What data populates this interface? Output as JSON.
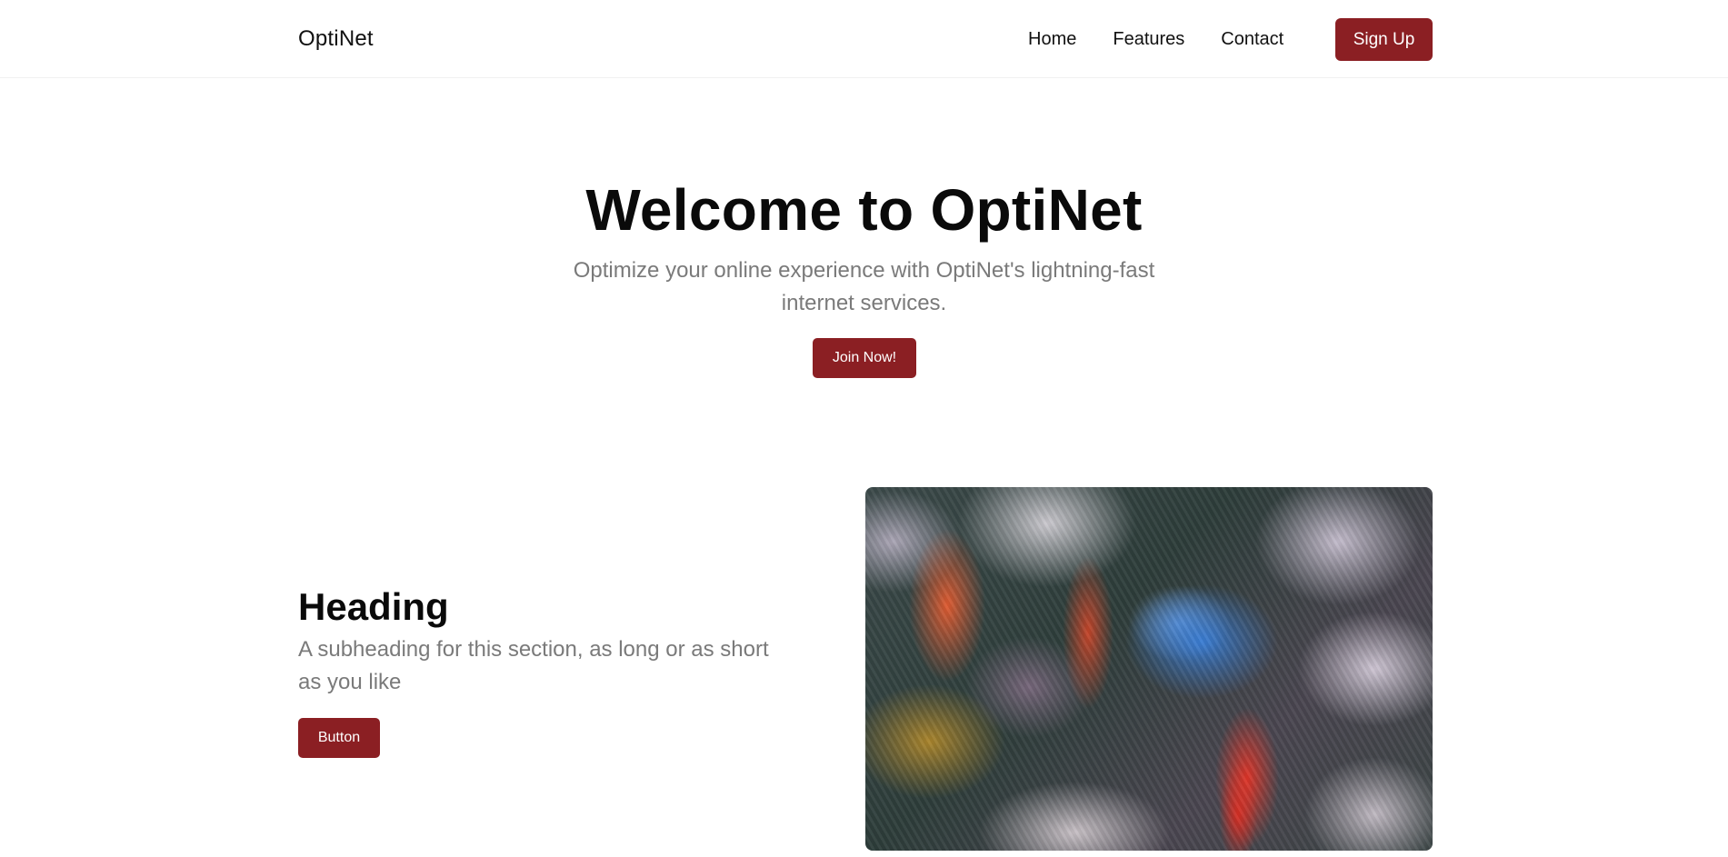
{
  "header": {
    "logo": "OptiNet",
    "nav": [
      {
        "label": "Home"
      },
      {
        "label": "Features"
      },
      {
        "label": "Contact"
      }
    ],
    "signup_label": "Sign Up"
  },
  "hero": {
    "title": "Welcome to OptiNet",
    "subtitle": "Optimize your online experience with OptiNet's lightning-fast internet services.",
    "cta_label": "Join Now!"
  },
  "feature": {
    "heading": "Heading",
    "subheading": "A subheading for this section, as long or as short as you like",
    "button_label": "Button",
    "image_alt": "blurred-flower-field-photo"
  },
  "colors": {
    "accent": "#8b1f23",
    "muted_text": "#7a7a7a"
  }
}
